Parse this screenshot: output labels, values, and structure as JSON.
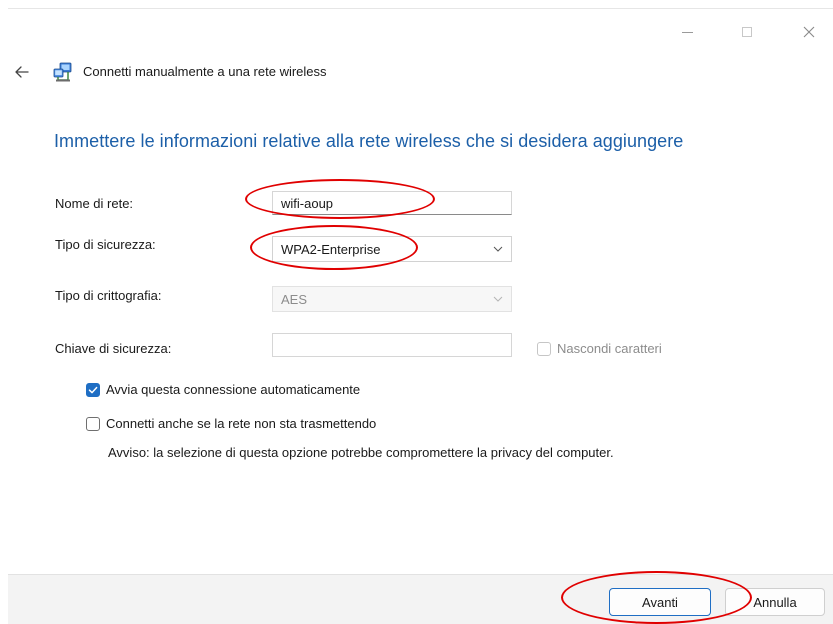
{
  "window": {
    "title": "Connetti manualmente a una rete wireless"
  },
  "heading": "Immettere le informazioni relative alla rete wireless che si desidera aggiungere",
  "form": {
    "network_name": {
      "label": "Nome di rete:",
      "value": "wifi-aoup"
    },
    "security_type": {
      "label": "Tipo di sicurezza:",
      "value": "WPA2-Enterprise"
    },
    "encryption_type": {
      "label": "Tipo di crittografia:",
      "value": "AES",
      "disabled": true
    },
    "security_key": {
      "label": "Chiave di sicurezza:",
      "value": "",
      "disabled": true
    },
    "hide_chars": {
      "label": "Nascondi caratteri",
      "checked": false,
      "disabled": true
    }
  },
  "options": {
    "auto_start": {
      "label": "Avvia questa connessione automaticamente",
      "checked": true
    },
    "connect_hidden": {
      "label": "Connetti anche se la rete non sta trasmettendo",
      "checked": false
    },
    "warning": "Avviso: la selezione di questa opzione potrebbe compromettere la privacy del computer."
  },
  "buttons": {
    "next": "Avanti",
    "cancel": "Annulla"
  },
  "icons": {
    "back": "back-arrow-icon",
    "network": "network-icon",
    "minimize": "minimize-icon",
    "maximize": "maximize-icon",
    "close": "close-icon",
    "dropdown": "chevron-down-icon",
    "check": "checkmark-icon"
  },
  "colors": {
    "heading": "#1c5fa8",
    "accent": "#1f6ec4",
    "annotation": "#e00000"
  }
}
